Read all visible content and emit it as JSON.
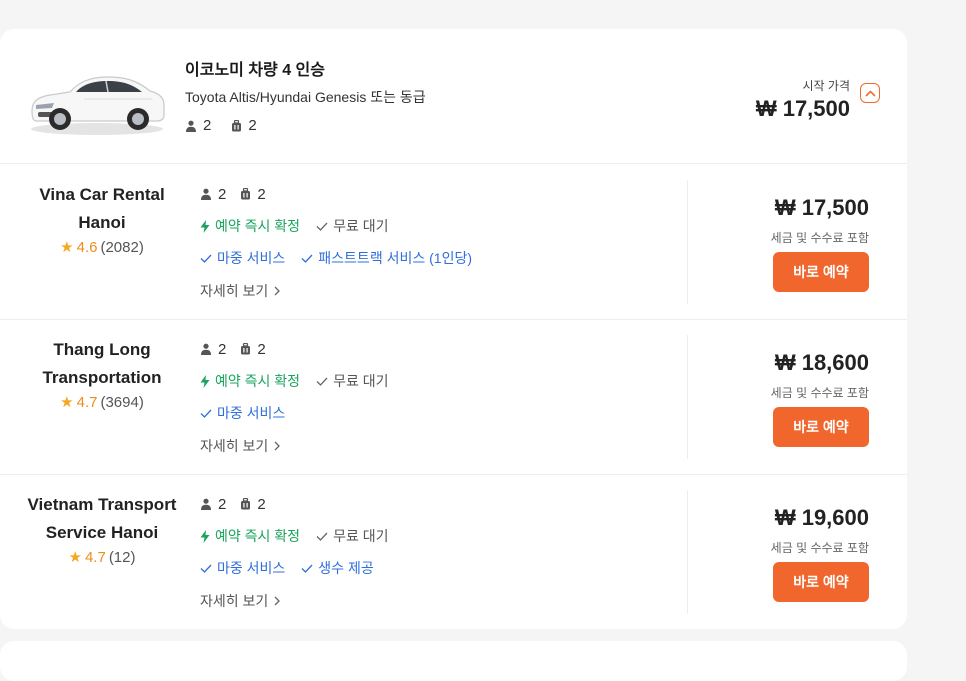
{
  "car": {
    "title": "이코노미 차량 4 인승",
    "subtitle": "Toyota Altis/Hyundai Genesis 또는 동급",
    "passengers": "2",
    "luggage": "2",
    "start_label": "시작 가격",
    "start_price": "₩ 17,500"
  },
  "offers": [
    {
      "vendor": "Vina Car Rental Hanoi",
      "rating": "4.6",
      "reviews": "(2082)",
      "passengers": "2",
      "luggage": "2",
      "instant": "예약 즉시 확정",
      "free_wait": "무료 대기",
      "services": [
        "마중 서비스",
        "패스트트랙 서비스 (1인당)"
      ],
      "more": "자세히 보기",
      "price": "₩ 17,500",
      "tax": "세금 및 수수료 포함",
      "book": "바로 예약"
    },
    {
      "vendor": "Thang Long Transportation",
      "rating": "4.7",
      "reviews": "(3694)",
      "passengers": "2",
      "luggage": "2",
      "instant": "예약 즉시 확정",
      "free_wait": "무료 대기",
      "services": [
        "마중 서비스"
      ],
      "more": "자세히 보기",
      "price": "₩ 18,600",
      "tax": "세금 및 수수료 포함",
      "book": "바로 예약"
    },
    {
      "vendor": "Vietnam Transport Service Hanoi",
      "rating": "4.7",
      "reviews": "(12)",
      "passengers": "2",
      "luggage": "2",
      "instant": "예약 즉시 확정",
      "free_wait": "무료 대기",
      "services": [
        "마중 서비스",
        "생수 제공"
      ],
      "more": "자세히 보기",
      "price": "₩ 19,600",
      "tax": "세금 및 수수료 포함",
      "book": "바로 예약"
    }
  ],
  "colors": {
    "accent": "#f0662c",
    "green": "#1aa35c",
    "blue": "#2f6fdc",
    "star": "#f5a623"
  },
  "icons": {
    "person": "person-icon",
    "luggage": "luggage-icon",
    "bolt": "lightning-icon",
    "check": "check-icon",
    "chevron_right": "chevron-right-icon",
    "chevron_up": "chevron-up-icon",
    "star": "star-icon"
  }
}
